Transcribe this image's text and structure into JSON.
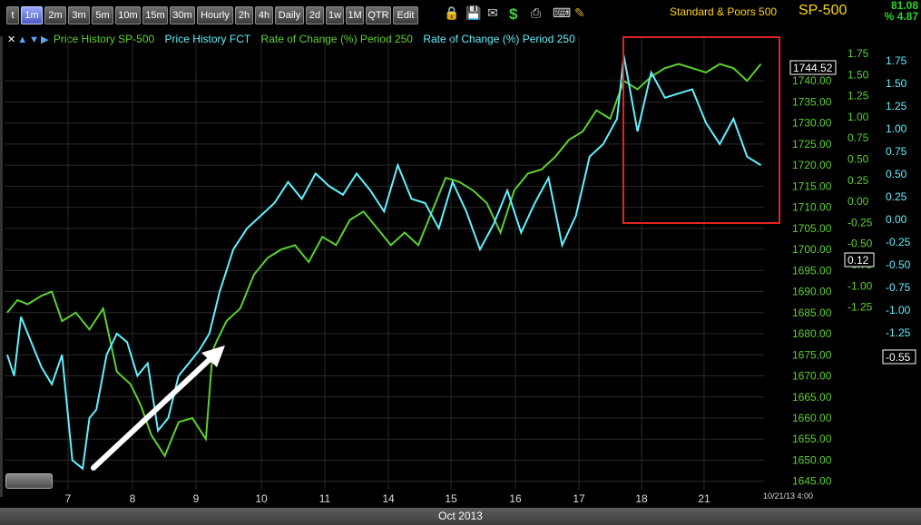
{
  "toolbar": {
    "buttons": [
      "t",
      "1m",
      "2m",
      "3m",
      "5m",
      "10m",
      "15m",
      "30m",
      "Hourly",
      "2h",
      "4h",
      "Daily",
      "2d",
      "1w",
      "1M",
      "QTR",
      "Edit"
    ],
    "active": "1m",
    "icons": [
      "lock-icon",
      "save-icon",
      "mail-icon",
      "dollar-icon",
      "print-icon",
      "keyboard-icon",
      "pencil-icon"
    ],
    "title": "Standard & Poors 500",
    "symbol": "SP-500",
    "change": "81.08",
    "change_pct": "% 4.87"
  },
  "legend": {
    "items": [
      {
        "label": "Price History SP-500",
        "color": "#5cd12f"
      },
      {
        "label": "Price History FCT",
        "color": "#5ff2ff"
      },
      {
        "label": "Rate of Change (%) Period 250",
        "color": "#5cd12f"
      },
      {
        "label": "Rate of Change (%) Period 250",
        "color": "#5ff2ff"
      }
    ]
  },
  "footer": {
    "month": "Oct 2013",
    "timestamp": "10/21/13 4:00"
  },
  "chart_data": {
    "type": "line",
    "x_labels": [
      "7",
      "8",
      "9",
      "10",
      "11",
      "14",
      "15",
      "16",
      "17",
      "18",
      "21"
    ],
    "price_axis": {
      "ticks": [
        1645.0,
        1650.0,
        1655.0,
        1660.0,
        1665.0,
        1670.0,
        1675.0,
        1680.0,
        1685.0,
        1690.0,
        1695.0,
        1700.0,
        1705.0,
        1710.0,
        1715.0,
        1720.0,
        1725.0,
        1730.0,
        1735.0,
        1740.0
      ],
      "range": [
        1643,
        1748
      ],
      "last_value": "1744.52"
    },
    "roc_axis_1": {
      "ticks": [
        "1.75",
        "1.50",
        "1.25",
        "1.00",
        "0.75",
        "0.50",
        "0.25",
        "0.00",
        "-0.25",
        "-0.50",
        "-0.75",
        "-1.00",
        "-1.25"
      ],
      "last_value": "0.12"
    },
    "roc_axis_2": {
      "ticks": [
        "1.75",
        "1.50",
        "1.25",
        "1.00",
        "0.75",
        "0.50",
        "0.25",
        "0.00",
        "-0.25",
        "-0.50",
        "-0.75",
        "-1.00",
        "-1.25"
      ],
      "last_value": "-0.55"
    },
    "series": [
      {
        "name": "Price History SP-500",
        "color": "#5cd12f",
        "x": [
          0,
          0.15,
          0.3,
          0.5,
          0.65,
          0.8,
          1.0,
          1.2,
          1.4,
          1.6,
          1.8,
          1.95,
          2.1,
          2.3,
          2.5,
          2.7,
          2.9,
          3.0,
          3.05,
          3.2,
          3.4,
          3.6,
          3.8,
          4.0,
          4.2,
          4.4,
          4.6,
          4.8,
          5.0,
          5.2,
          5.4,
          5.6,
          5.8,
          6.0,
          6.2,
          6.4,
          6.6,
          6.8,
          7.0,
          7.2,
          7.4,
          7.6,
          7.8,
          8.0,
          8.2,
          8.4,
          8.6,
          8.8,
          9.0,
          9.2,
          9.4,
          9.6,
          9.8,
          10.0,
          10.2,
          10.4,
          10.6,
          10.8,
          11.0
        ],
        "y": [
          1685,
          1688,
          1687,
          1689,
          1690,
          1683,
          1685,
          1681,
          1686,
          1671,
          1668,
          1663,
          1656,
          1651,
          1659,
          1660,
          1655,
          1676,
          1678,
          1683,
          1686,
          1694,
          1698,
          1700,
          1701,
          1697,
          1703,
          1701,
          1707,
          1709,
          1705,
          1701,
          1704,
          1701,
          1709,
          1717,
          1716,
          1714,
          1711,
          1704,
          1714,
          1718,
          1719,
          1722,
          1726,
          1728,
          1733,
          1731,
          1740,
          1738,
          1741,
          1743,
          1744,
          1743,
          1742,
          1744,
          1743,
          1740,
          1744
        ]
      },
      {
        "name": "Price History FCT",
        "color": "#5ff2ff",
        "x": [
          0,
          0.1,
          0.2,
          0.35,
          0.5,
          0.65,
          0.8,
          0.95,
          1.1,
          1.2,
          1.3,
          1.45,
          1.6,
          1.75,
          1.9,
          2.05,
          2.2,
          2.35,
          2.5,
          2.65,
          2.8,
          2.95,
          3.1,
          3.3,
          3.5,
          3.7,
          3.9,
          4.1,
          4.3,
          4.5,
          4.7,
          4.9,
          5.1,
          5.3,
          5.5,
          5.7,
          5.9,
          6.1,
          6.3,
          6.5,
          6.7,
          6.9,
          7.1,
          7.3,
          7.5,
          7.7,
          7.9,
          8.1,
          8.3,
          8.5,
          8.7,
          8.9,
          9.0,
          9.2,
          9.4,
          9.6,
          9.8,
          10.0,
          10.2,
          10.4,
          10.6,
          10.8,
          11.0
        ],
        "y": [
          1675,
          1670,
          1684,
          1678,
          1672,
          1668,
          1675,
          1650,
          1648,
          1660,
          1662,
          1675,
          1680,
          1678,
          1670,
          1673,
          1657,
          1660,
          1670,
          1673,
          1676,
          1680,
          1690,
          1700,
          1705,
          1708,
          1711,
          1716,
          1712,
          1718,
          1715,
          1713,
          1718,
          1714,
          1709,
          1720,
          1712,
          1711,
          1705,
          1716,
          1709,
          1700,
          1706,
          1714,
          1704,
          1711,
          1717,
          1701,
          1708,
          1722,
          1725,
          1731,
          1746,
          1728,
          1742,
          1736,
          1737,
          1738,
          1730,
          1725,
          1731,
          1722,
          1720
        ]
      }
    ],
    "annotations": [
      "white-arrow",
      "red-rectangle"
    ]
  }
}
